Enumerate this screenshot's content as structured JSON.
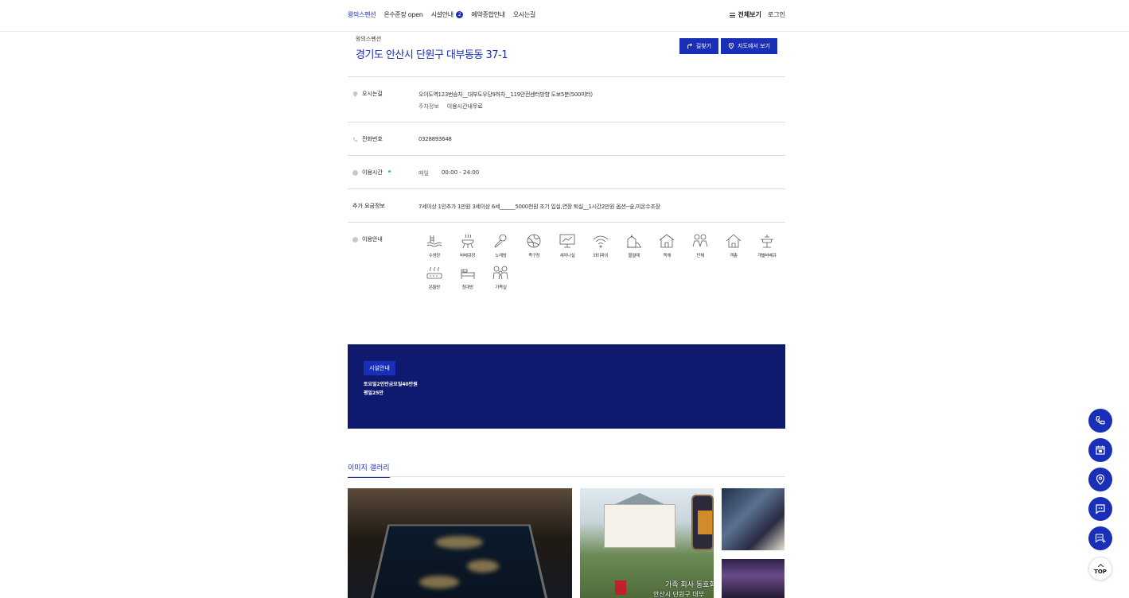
{
  "nav": {
    "items": [
      {
        "label": "왕의스펜션",
        "active": true
      },
      {
        "label": "온수준장 open"
      },
      {
        "label": "시설안내",
        "badge": "2"
      },
      {
        "label": "예약종합안내"
      },
      {
        "label": "오시는길"
      }
    ],
    "all_menu": "전체보기",
    "login": "로그인"
  },
  "place": {
    "name": "왕의스펜션",
    "address": "경기도 안산시 단원구 대부동동 37-1",
    "btn_directions": "길찾기",
    "btn_map": "지도에서 보기"
  },
  "info": {
    "directions": {
      "label": "오시는길",
      "value": "오이도역123번승차__대부도우당9하차__119안전센터방향 도보5분(500미터)",
      "parking_label": "주차정보",
      "parking_value": "이용시간내무료"
    },
    "phone": {
      "label": "전화번호",
      "value": "0328893648"
    },
    "hours": {
      "label": "이용시간",
      "day": "매일",
      "time": "00:00 - 24:00"
    },
    "fee": {
      "label": "추가 요금정보",
      "value": "7세이상 1인추가 1만원 3세이상 6세______5000천원 조기 입실,연장 퇴실__1시간2만원 옵션--숯,미온수조장"
    },
    "amenities": {
      "label": "이용안내",
      "items": [
        {
          "name": "수영장",
          "icon": "pool-icon"
        },
        {
          "name": "바베큐장",
          "icon": "bbq-icon"
        },
        {
          "name": "노래방",
          "icon": "mic-icon"
        },
        {
          "name": "족구장",
          "icon": "ball-icon"
        },
        {
          "name": "세미나실",
          "icon": "seminar-icon"
        },
        {
          "name": "와이파이",
          "icon": "wifi-icon"
        },
        {
          "name": "물썰매",
          "icon": "sled-icon"
        },
        {
          "name": "독채",
          "icon": "house-icon"
        },
        {
          "name": "단체",
          "icon": "group-icon"
        },
        {
          "name": "객총",
          "icon": "home-icon"
        },
        {
          "name": "개별바베큐",
          "icon": "grill-icon"
        },
        {
          "name": "온돌방",
          "icon": "ondol-icon"
        },
        {
          "name": "침대방",
          "icon": "bed-icon"
        },
        {
          "name": "가족실",
          "icon": "family-icon"
        }
      ]
    }
  },
  "notice": {
    "tag": "시설안내",
    "lines": [
      "토요일2인만금요일40만원",
      "평일25만"
    ]
  },
  "gallery": {
    "title": "이미지 갤러리",
    "caption1": "가족 회사 동호회",
    "caption2": "안산시 단원구 대부"
  },
  "floating": {
    "top_label": "TOP"
  },
  "colors": {
    "accent": "#1a2fb8",
    "notice_bg": "#0f1a6e"
  }
}
